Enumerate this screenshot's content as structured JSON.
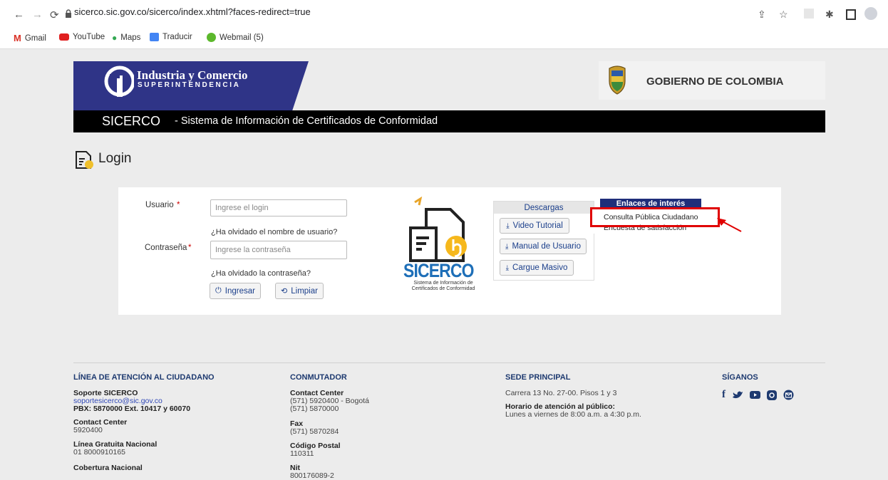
{
  "browser": {
    "url": "sicerco.sic.gov.co/sicerco/index.xhtml?faces-redirect=true",
    "bookmarks": [
      "Gmail",
      "YouTube",
      "Maps",
      "Traducir",
      "Webmail (5)"
    ]
  },
  "header": {
    "brand_line1": "Industria y Comercio",
    "brand_line2": "SUPERINTENDENCIA",
    "gov": "GOBIERNO DE COLOMBIA",
    "system_name": "SICERCO",
    "system_desc": " - Sistema de Información de Certificados de Conformidad"
  },
  "login": {
    "title": "Login",
    "user_label": "Usuario",
    "user_placeholder": "Ingrese el login",
    "forgot_user": "¿Ha olvidado el nombre de usuario?",
    "pass_label": "Contraseña",
    "pass_placeholder": "Ingrese la contraseña",
    "forgot_pass": "¿Ha olvidado la contraseña?",
    "required_mark": "*",
    "ingresar": "Ingresar",
    "limpiar": "Limpiar"
  },
  "logo": {
    "name": "SICERCO",
    "subtitle1": "Sistema de Información de",
    "subtitle2": "Certificados de Conformidad"
  },
  "downloads": {
    "title": "Descargas",
    "items": [
      "Video Tutorial",
      "Manual de Usuario",
      "Cargue Masivo"
    ]
  },
  "links": {
    "title": "Enlaces de interés",
    "items": [
      "Consulta Pública Ciudadano",
      "Encuesta de satisfacción"
    ]
  },
  "footer": {
    "col1": {
      "title": "LÍNEA DE ATENCIÓN AL CIUDADANO",
      "soporte": "Soporte SICERCO",
      "email": "soportesicerco@sic.gov.co",
      "pbx": "PBX: 5870000 Ext. 10417 y 60070",
      "cc_label": "Contact Center",
      "cc_value": "5920400",
      "lgn_label": "Línea Gratuita Nacional",
      "lgn_value": "01 8000910165",
      "cob_label": "Cobertura Nacional"
    },
    "col2": {
      "title": "CONMUTADOR",
      "cc_label": "Contact Center",
      "cc_line1": "(571) 5920400 - Bogotá",
      "cc_line2": "(571) 5870000",
      "fax_label": "Fax",
      "fax_value": "(571) 5870284",
      "cp_label": "Código Postal",
      "cp_value": "110311",
      "nit_label": "Nit",
      "nit_value": "800176089-2"
    },
    "col3": {
      "title": "SEDE PRINCIPAL",
      "address": "Carrera 13 No. 27-00. Pisos 1 y 3",
      "hours_label": "Horario de atención al público:",
      "hours_value": "Lunes a viernes de 8:00 a.m. a 4:30 p.m."
    },
    "col4": {
      "title": "SÍGANOS"
    }
  },
  "colors": {
    "navy": "#2f3487",
    "highlight": "#e00000",
    "link_header": "#1f2e7a"
  }
}
